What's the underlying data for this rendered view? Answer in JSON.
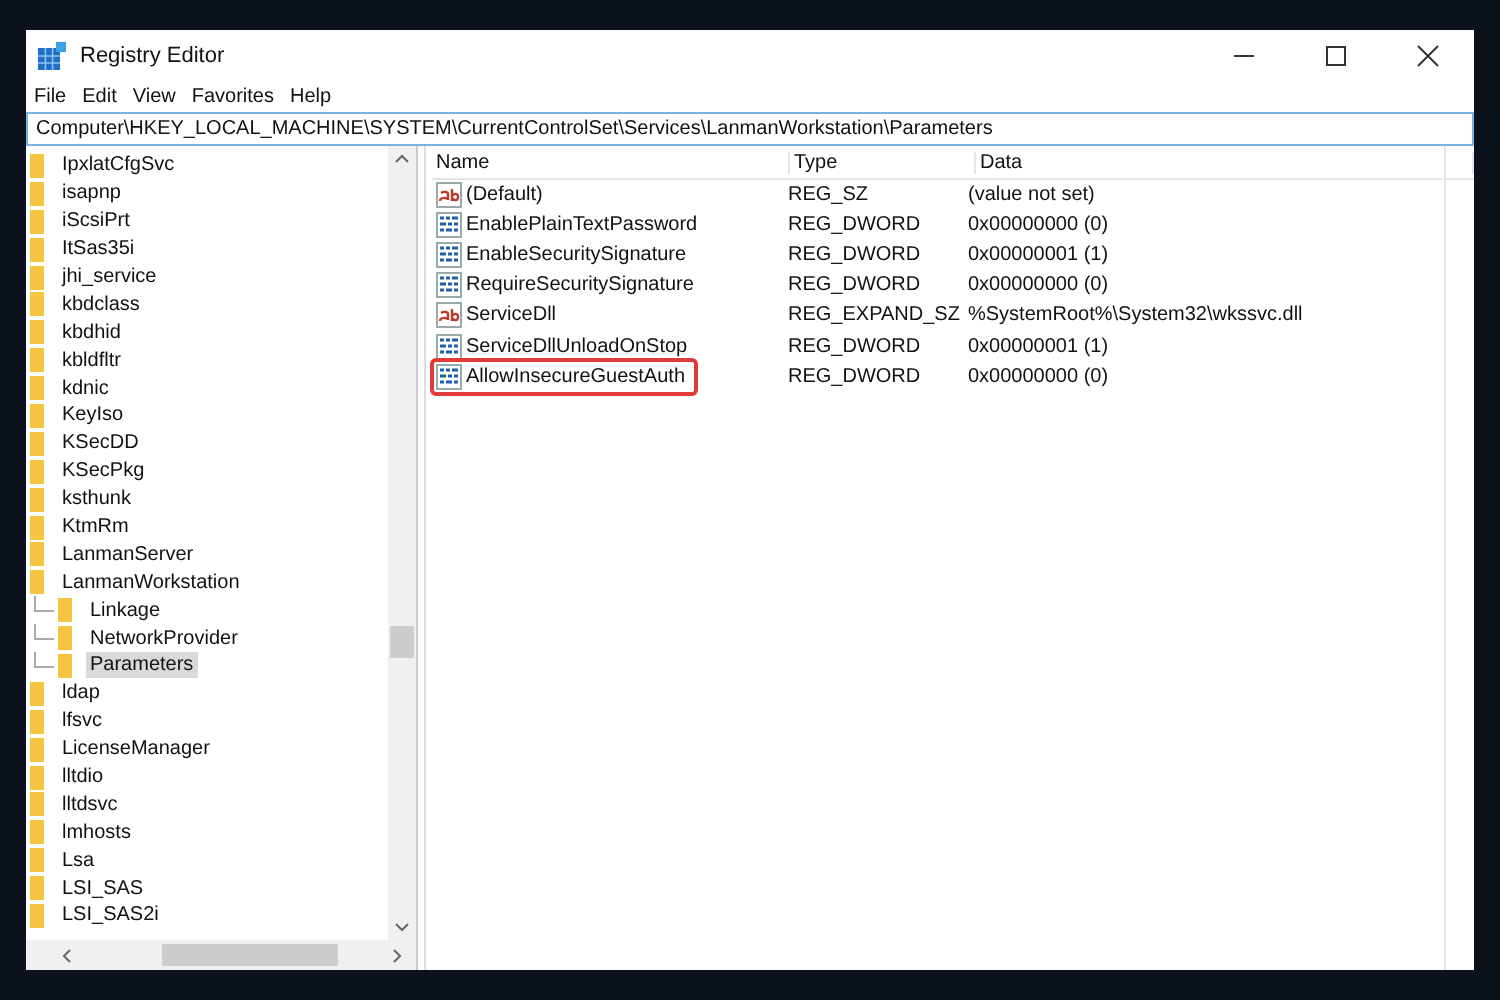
{
  "window": {
    "title": "Registry Editor"
  },
  "menu": [
    "File",
    "Edit",
    "View",
    "Favorites",
    "Help"
  ],
  "address": "Computer\\HKEY_LOCAL_MACHINE\\SYSTEM\\CurrentControlSet\\Services\\LanmanWorkstation\\Parameters",
  "tree": [
    {
      "label": "IpxlatCfgSvc",
      "selected": false
    },
    {
      "label": "isapnp",
      "selected": false
    },
    {
      "label": "iScsiPrt",
      "selected": false
    },
    {
      "label": "ItSas35i",
      "selected": false
    },
    {
      "label": "jhi_service",
      "selected": false
    },
    {
      "label": "kbdclass",
      "selected": false
    },
    {
      "label": "kbdhid",
      "selected": false
    },
    {
      "label": "kbldfltr",
      "selected": false
    },
    {
      "label": "kdnic",
      "selected": false
    },
    {
      "label": "KeyIso",
      "selected": false
    },
    {
      "label": "KSecDD",
      "selected": false
    },
    {
      "label": "KSecPkg",
      "selected": false
    },
    {
      "label": "ksthunk",
      "selected": false
    },
    {
      "label": "KtmRm",
      "selected": false
    },
    {
      "label": "LanmanServer",
      "selected": false
    },
    {
      "label": "LanmanWorkstation",
      "selected": false,
      "children": [
        {
          "label": "Linkage",
          "selected": false
        },
        {
          "label": "NetworkProvider",
          "selected": false
        },
        {
          "label": "Parameters",
          "selected": true
        }
      ]
    },
    {
      "label": "ldap",
      "selected": false
    },
    {
      "label": "lfsvc",
      "selected": false
    },
    {
      "label": "LicenseManager",
      "selected": false
    },
    {
      "label": "lltdio",
      "selected": false
    },
    {
      "label": "lltdsvc",
      "selected": false
    },
    {
      "label": "lmhosts",
      "selected": false
    },
    {
      "label": "Lsa",
      "selected": false
    },
    {
      "label": "LSI_SAS",
      "selected": false
    },
    {
      "label": "LSI_SAS2i",
      "selected": false
    }
  ],
  "table": {
    "columns": [
      "Name",
      "Type",
      "Data"
    ],
    "rows": [
      {
        "kind": "string",
        "name": "(Default)",
        "type": "REG_SZ",
        "data": "(value not set)",
        "highlighted": false
      },
      {
        "kind": "binary",
        "name": "EnablePlainTextPassword",
        "type": "REG_DWORD",
        "data": "0x00000000 (0)",
        "highlighted": false
      },
      {
        "kind": "binary",
        "name": "EnableSecuritySignature",
        "type": "REG_DWORD",
        "data": "0x00000001 (1)",
        "highlighted": false
      },
      {
        "kind": "binary",
        "name": "RequireSecuritySignature",
        "type": "REG_DWORD",
        "data": "0x00000000 (0)",
        "highlighted": false
      },
      {
        "kind": "string",
        "name": "ServiceDll",
        "type": "REG_EXPAND_SZ",
        "data": "%SystemRoot%\\System32\\wkssvc.dll",
        "highlighted": false
      },
      {
        "kind": "binary",
        "name": "ServiceDllUnloadOnStop",
        "type": "REG_DWORD",
        "data": "0x00000001 (1)",
        "highlighted": false
      },
      {
        "kind": "binary",
        "name": "AllowInsecureGuestAuth",
        "type": "REG_DWORD",
        "data": "0x00000000 (0)",
        "highlighted": true
      }
    ]
  }
}
